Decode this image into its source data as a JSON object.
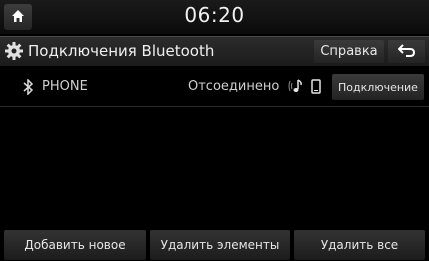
{
  "status": {
    "time": "06:20"
  },
  "header": {
    "title": "Подключения Bluetooth",
    "help_label": "Справка"
  },
  "devices": [
    {
      "name": "PHONE",
      "status": "Отсоединено",
      "connect_label": "Подключение"
    }
  ],
  "footer": {
    "add_label": "Добавить новое",
    "delete_items_label": "Удалить элементы",
    "delete_all_label": "Удалить все"
  },
  "icons": {
    "home": "home-icon",
    "settings": "gear-icon",
    "back": "back-arrow-icon",
    "bluetooth": "bluetooth-icon",
    "audio": "bluetooth-audio-icon",
    "phone": "phone-icon"
  },
  "colors": {
    "background": "#000000",
    "button": "#2e2e2e",
    "text": "#e6e6e6"
  }
}
